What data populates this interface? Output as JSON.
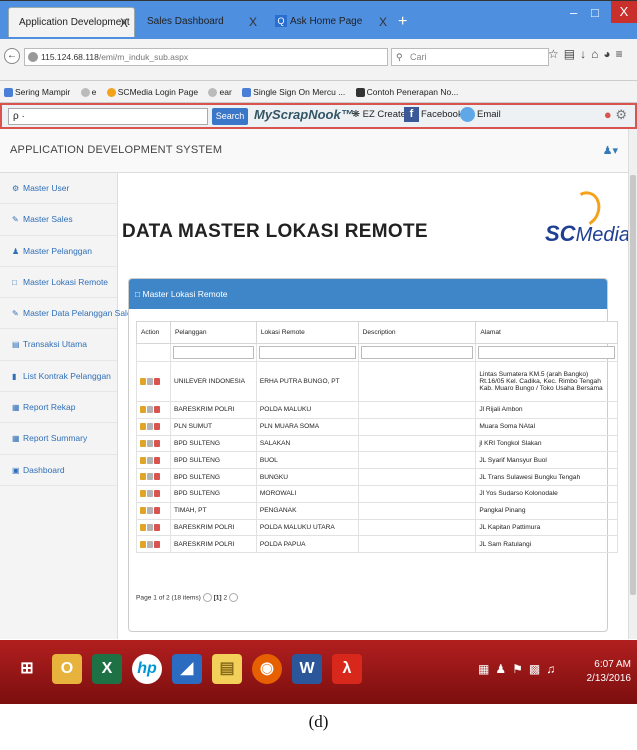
{
  "browser": {
    "tabs": [
      {
        "label": "Application Development",
        "close": "X"
      },
      {
        "label": "Sales Dashboard",
        "close": "X"
      },
      {
        "label": "Ask Home Page",
        "close": "X"
      }
    ],
    "new_tab": "+",
    "window_controls": {
      "minimize": "–",
      "maximize": "□",
      "close": "X"
    },
    "url": {
      "host": "115.124.68.118",
      "path": "/emi/m_induk_sub.aspx"
    },
    "search_placeholder": "Cari",
    "bookmarks": [
      "Sering Mampir",
      "e",
      "SCMedia Login Page",
      "ear",
      "Single Sign On Mercu ...",
      "Contoh Penerapan No..."
    ],
    "toolbar": {
      "search_value": "ρ ·",
      "search_button": "Search",
      "brand": "MyScrapNook™",
      "ez_create": "EZ Create",
      "facebook": "Facebook",
      "email": "Email"
    }
  },
  "app": {
    "header_title": "APPLICATION DEVELOPMENT SYSTEM",
    "sidebar": [
      "Master User",
      "Master Sales",
      "Master Pelanggan",
      "Master Lokasi Remote",
      "Master Data Pelanggan Sales",
      "Transaksi Utama",
      "List Kontrak Pelanggan",
      "Report Rekap",
      "Report Summary",
      "Dashboard"
    ],
    "page_title": "DATA MASTER LOKASI REMOTE",
    "logo": {
      "sc": "SC",
      "media": "Media"
    },
    "panel_title": "Master Lokasi Remote",
    "table": {
      "columns": [
        "Action",
        "Pelanggan",
        "Lokasi Remote",
        "Description",
        "Alamat"
      ],
      "rows": [
        {
          "pelanggan": "UNILEVER INDONESIA",
          "lokasi": "ERHA PUTRA BUNGO, PT",
          "description": "",
          "alamat": "Lintas Sumatera KM.5 (arah Bangko) Rt.16/05 Kel. Cadika, Kec. Rimbo Tengah Kab. Muaro Bungo / Toko Usaha Bersama"
        },
        {
          "pelanggan": "BARESKRIM POLRI",
          "lokasi": "POLDA MALUKU",
          "description": "",
          "alamat": "Jl Rijali Ambon"
        },
        {
          "pelanggan": "PLN SUMUT",
          "lokasi": "PLN MUARA SOMA",
          "description": "",
          "alamat": "Muara Soma NAtal"
        },
        {
          "pelanggan": "BPD SULTENG",
          "lokasi": "SALAKAN",
          "description": "",
          "alamat": "jl KRI Tongkol Slakan"
        },
        {
          "pelanggan": "BPD SULTENG",
          "lokasi": "BUOL",
          "description": "",
          "alamat": "JL Syarif Mansyur Buol"
        },
        {
          "pelanggan": "BPD SULTENG",
          "lokasi": "BUNGKU",
          "description": "",
          "alamat": "JL Trans Sulawesi Bungku Tengah"
        },
        {
          "pelanggan": "BPD SULTENG",
          "lokasi": "MOROWALI",
          "description": "",
          "alamat": "Jl Yos Sudarso Kolonodale"
        },
        {
          "pelanggan": "TIMAH, PT",
          "lokasi": "PENGANAK",
          "description": "",
          "alamat": "Pangkal Pinang"
        },
        {
          "pelanggan": "BARESKRIM POLRI",
          "lokasi": "POLDA MALUKU UTARA",
          "description": "",
          "alamat": "JL Kapitan Pattimura"
        },
        {
          "pelanggan": "BARESKRIM POLRI",
          "lokasi": "POLDA PAPUA",
          "description": "",
          "alamat": "JL Sam Ratulangi"
        }
      ]
    },
    "pager": {
      "info": "Page 1 of 2 (18 items)",
      "page1": "[1]",
      "page2": "2"
    }
  },
  "taskbar": {
    "icons": [
      "start",
      "outlook",
      "excel",
      "hp",
      "onenote",
      "explorer",
      "firefox",
      "word",
      "acrobat"
    ],
    "time": "6:07 AM",
    "date": "2/13/2016"
  },
  "caption": "(d)"
}
